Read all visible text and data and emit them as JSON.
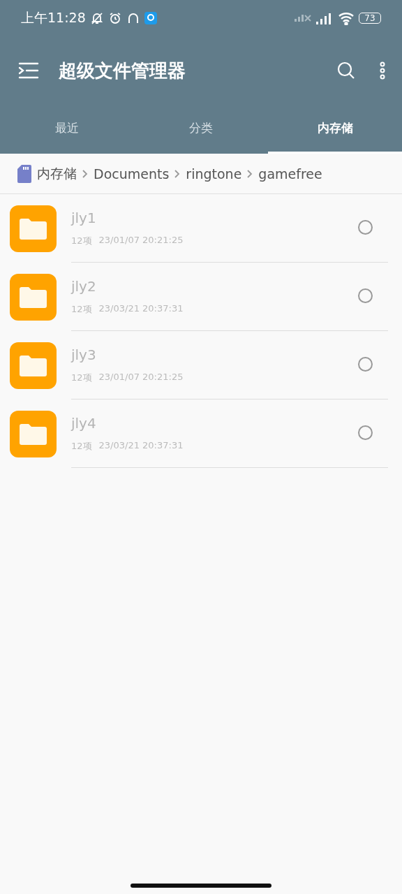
{
  "status_bar": {
    "time": "上午11:28",
    "battery": "73"
  },
  "app_bar": {
    "title": "超级文件管理器"
  },
  "tabs": [
    {
      "label": "最近",
      "selected": false
    },
    {
      "label": "分类",
      "selected": false
    },
    {
      "label": "内存储",
      "selected": true
    }
  ],
  "breadcrumb": [
    "内存储",
    "Documents",
    "ringtone",
    "gamefree"
  ],
  "files": [
    {
      "name": "jly1",
      "count": "12项",
      "modified": "23/01/07 20:21:25",
      "selected": false
    },
    {
      "name": "jly2",
      "count": "12项",
      "modified": "23/03/21 20:37:31",
      "selected": false
    },
    {
      "name": "jly3",
      "count": "12项",
      "modified": "23/01/07 20:21:25",
      "selected": false
    },
    {
      "name": "jly4",
      "count": "12项",
      "modified": "23/03/21 20:37:31",
      "selected": false
    }
  ]
}
